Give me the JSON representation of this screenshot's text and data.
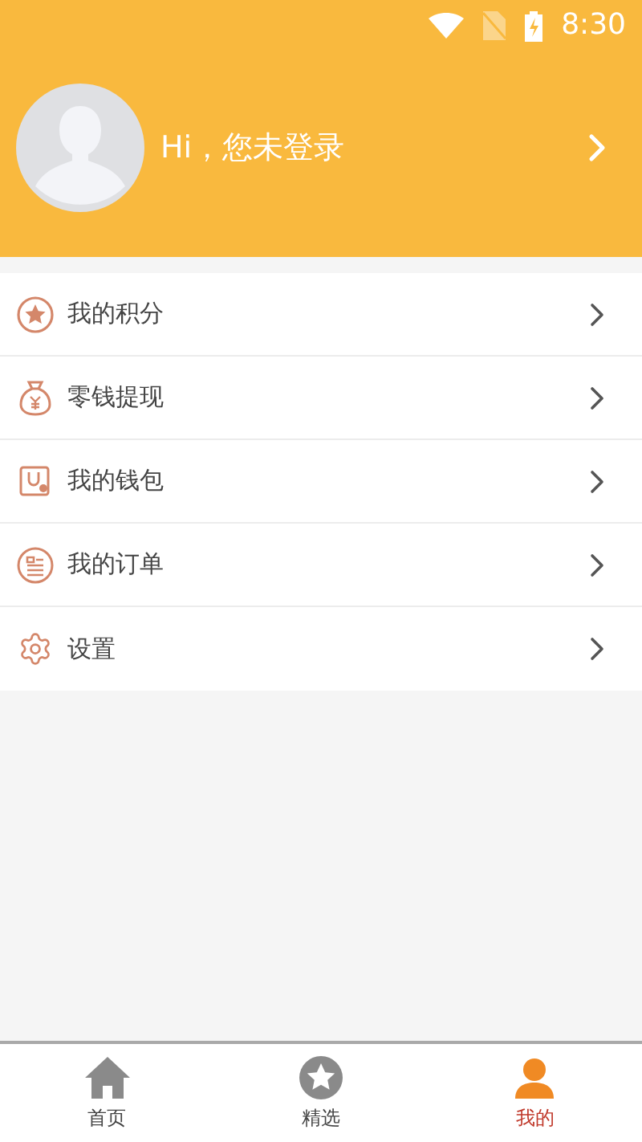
{
  "status_bar": {
    "time": "8:30"
  },
  "profile": {
    "greeting": "Hi，您未登录"
  },
  "menu": [
    {
      "label": "我的积分",
      "kind": "points"
    },
    {
      "label": "零钱提现",
      "kind": "withdraw"
    },
    {
      "label": "我的钱包",
      "kind": "wallet"
    },
    {
      "label": "我的订单",
      "kind": "orders"
    },
    {
      "label": "设置",
      "kind": "settings"
    }
  ],
  "tabs": [
    {
      "label": "首页",
      "kind": "home",
      "selected": false
    },
    {
      "label": "精选",
      "kind": "featured",
      "selected": false
    },
    {
      "label": "我的",
      "kind": "mine",
      "selected": true
    }
  ]
}
